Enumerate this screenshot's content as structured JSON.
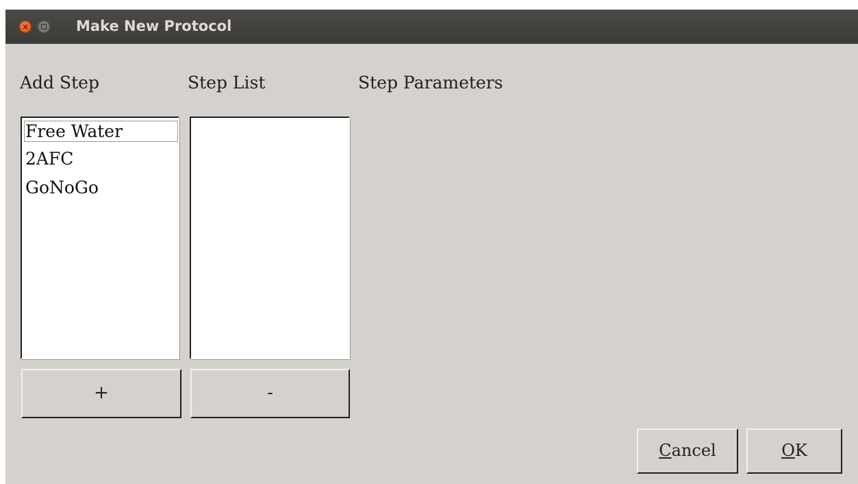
{
  "window": {
    "title": "Make New Protocol",
    "close_glyph": "×"
  },
  "labels": {
    "add_step": "Add Step",
    "step_list": "Step List",
    "step_parameters": "Step Parameters"
  },
  "add_step_list": {
    "items": [
      "Free Water",
      "2AFC",
      "GoNoGo"
    ],
    "focused_index": 0
  },
  "step_list": {
    "items": []
  },
  "buttons": {
    "add": "+",
    "remove": "-",
    "cancel_mnemonic": "C",
    "cancel_rest": "ancel",
    "ok_mnemonic": "O",
    "ok_rest": "K"
  }
}
